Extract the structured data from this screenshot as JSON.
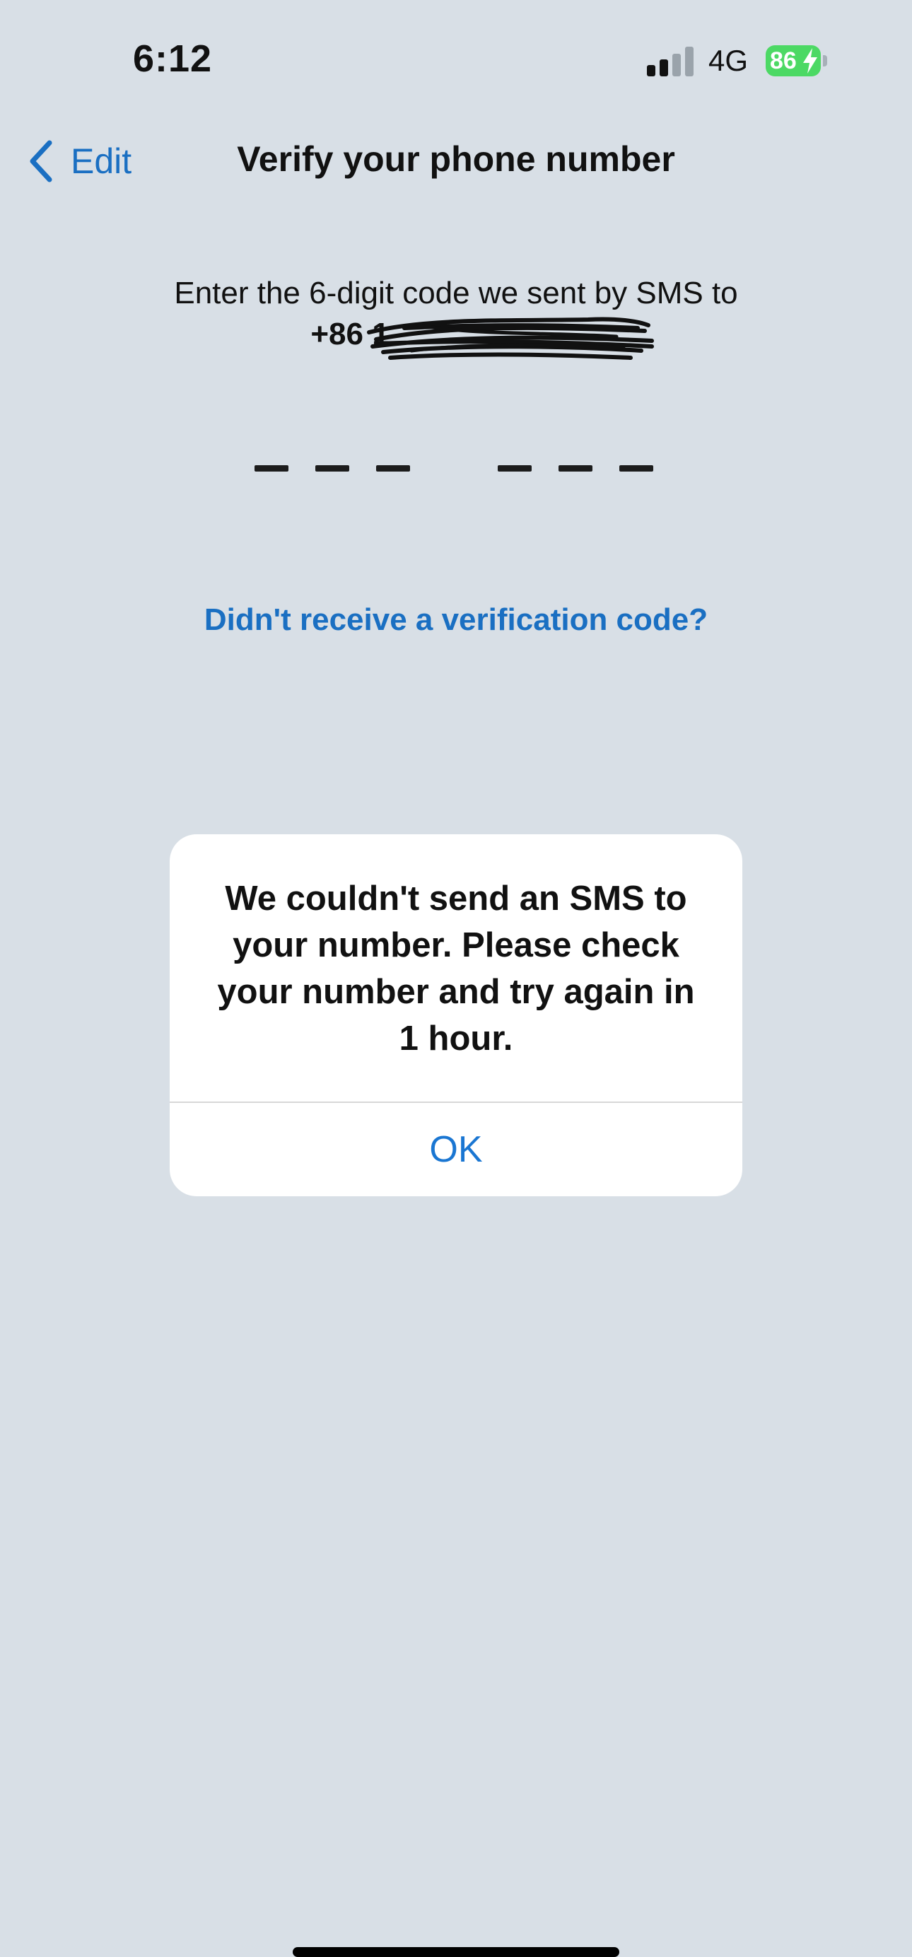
{
  "status_bar": {
    "time": "6:12",
    "network": "4G",
    "battery": "86",
    "signal_bars_active": 2,
    "signal_bars_total": 4
  },
  "nav": {
    "back_label": "Edit",
    "title": "Verify your phone number"
  },
  "content": {
    "instruction": "Enter the 6-digit code we sent by SMS to",
    "phone_prefix": "+86 1",
    "code_digits": 6,
    "resend_link": "Didn't receive a verification code?"
  },
  "alert": {
    "message": "We couldn't send an SMS to your number. Please check your number and try again in 1 hour.",
    "ok_label": "OK"
  },
  "colors": {
    "background": "#d8dfe6",
    "accent": "#1a6fc2",
    "battery": "#4cd964"
  }
}
